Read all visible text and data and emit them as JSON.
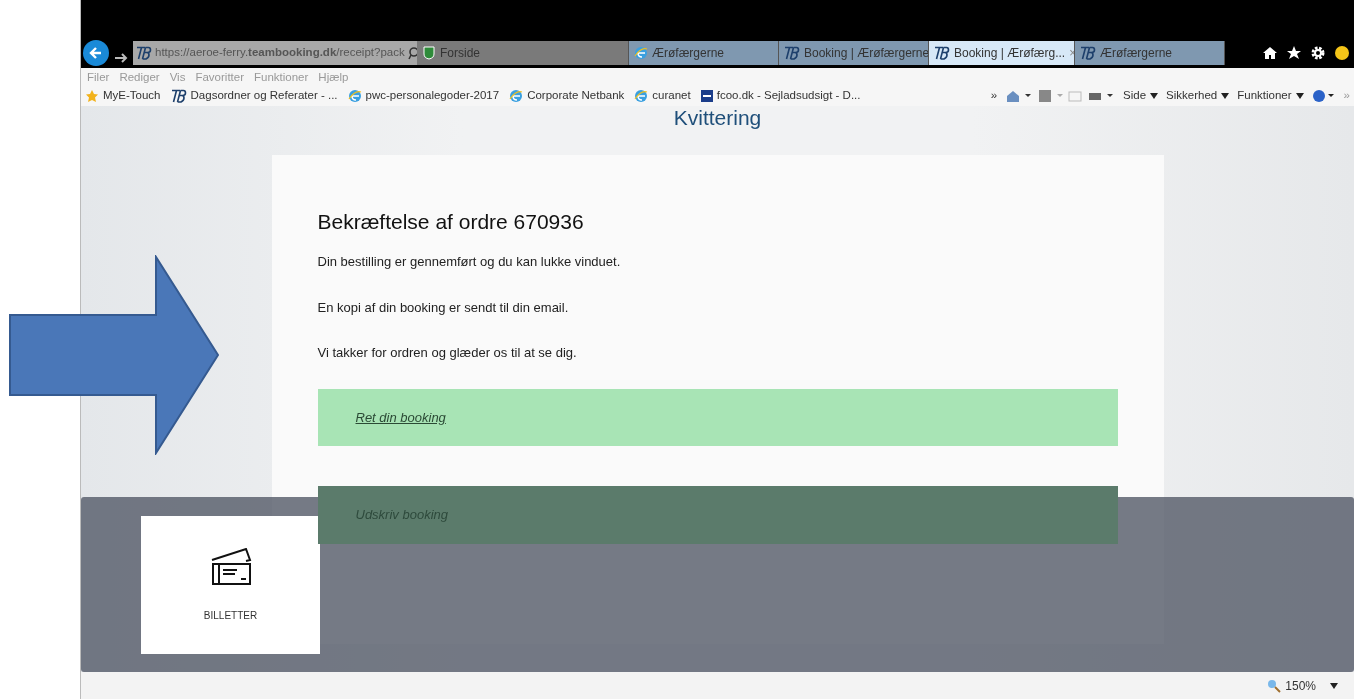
{
  "browser": {
    "url": "https://aeroe-ferry.**teambooking.dk**/receipt?pack",
    "tabs": [
      {
        "kind": "crest",
        "label": "Forside",
        "selected": false
      },
      {
        "kind": "ie",
        "label": "Ærøfærgerne",
        "selected": false
      },
      {
        "kind": "tb",
        "label": "Booking | Ærøfærgerne",
        "selected": false
      },
      {
        "kind": "tb",
        "label": "Booking | Ærøfærg...",
        "selected": true,
        "close": "×"
      },
      {
        "kind": "tb",
        "label": "Ærøfærgerne",
        "selected": false
      }
    ],
    "menu": [
      "Filer",
      "Rediger",
      "Vis",
      "Favoritter",
      "Funktioner",
      "Hjælp"
    ],
    "favorites": [
      {
        "kind": "star",
        "label": "MyE-Touch"
      },
      {
        "kind": "tb",
        "label": "Dagsordner og Referater - ..."
      },
      {
        "kind": "ie",
        "label": "pwc-personalegoder-2017"
      },
      {
        "kind": "ie",
        "label": "Corporate Netbank"
      },
      {
        "kind": "ie",
        "label": "curanet"
      },
      {
        "kind": "site",
        "label": "fcoo.dk - Sejladsudsigt - D..."
      }
    ],
    "command_bar": {
      "more": "»",
      "items": [
        "Side",
        "Sikkerhed",
        "Funktioner"
      ],
      "overflow": "»"
    },
    "zoom": "150%"
  },
  "page": {
    "heading": "Kvittering",
    "title": "Bekræftelse af ordre 670936",
    "paragraphs": [
      "Din bestilling er gennemført og du kan lukke vinduet.",
      "En kopi af din booking er sendt til din email.",
      "Vi takker for ordren og glæder os til at se dig."
    ],
    "actions": [
      {
        "label": "Ret din booking",
        "underline": true,
        "dimmed": false
      },
      {
        "label": "Udskriv booking",
        "underline": false,
        "dimmed": true
      }
    ],
    "tile": {
      "label": "BILLETTER"
    }
  }
}
